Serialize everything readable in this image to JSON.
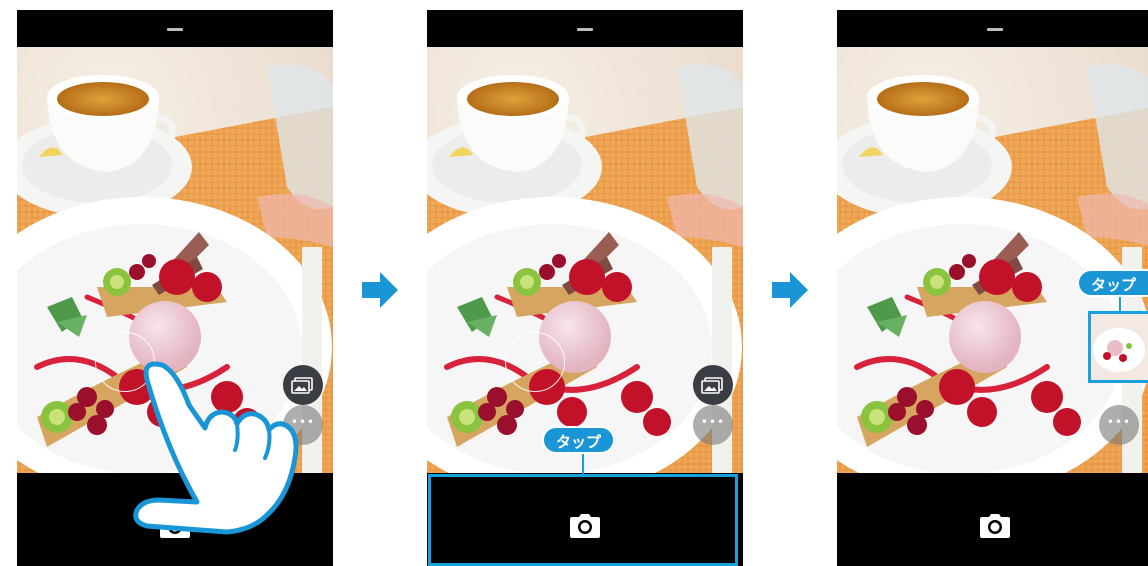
{
  "steps": [
    {
      "id": "step-1",
      "gesture": "hand-pointer-icon"
    },
    {
      "id": "step-2",
      "tap_label": "タップ",
      "target": "shutter-bar"
    },
    {
      "id": "step-3",
      "tap_label": "タップ",
      "target": "thumbnail"
    }
  ],
  "icons": {
    "shutter": "camera-icon",
    "gallery": "gallery-icon",
    "more": "more-icon",
    "flow": "arrow-right-icon"
  },
  "more_label": "•••",
  "colors": {
    "accent": "#1a95d6",
    "highlight": "#1aa0dd",
    "bar": "#000000"
  }
}
